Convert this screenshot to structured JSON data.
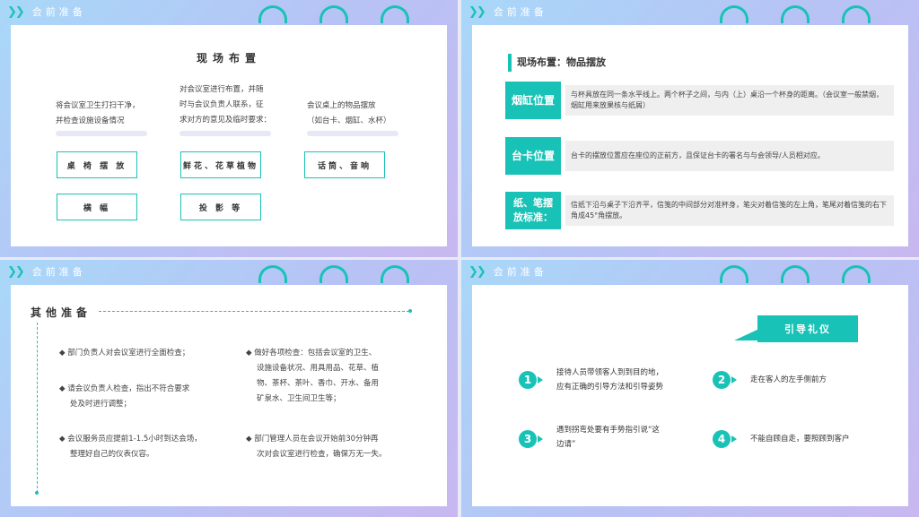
{
  "section_header": "会前准备",
  "panel1": {
    "title": "现场布置",
    "col1": [
      "将会议室卫生打扫干净，",
      "并检查设施设备情况"
    ],
    "col2": [
      "对会议室进行布置，并随",
      "时与会议负责人联系，征",
      "求对方的意见及临时要求："
    ],
    "col3": [
      "会议桌上的物品摆放",
      "（如台卡、烟缸、水杯）"
    ],
    "boxes": [
      "桌 椅 摆 放",
      "鲜花、花草植物",
      "话筒、音响",
      "横 幅",
      "投 影 等"
    ]
  },
  "panel2": {
    "title": "现场布置：物品摆放",
    "rows": [
      {
        "tag": "烟缸位置",
        "text": "与杯具放在同一条水平线上。两个杯子之间，与内（上）桌沿一个杯身的距离。（会议室一般禁烟，烟缸用来放果核与纸屑）"
      },
      {
        "tag": "台卡位置",
        "text": "台卡的摆放位置应在座位的正前方，且保证台卡的署名与与会领导/人员相对应。"
      },
      {
        "tag": "纸、笔摆放标准：",
        "text": "信纸下沿与桌子下沿齐平，信笺的中间部分对准杯身，笔尖对着信笺的左上角，笔尾对着信笺的右下角成45°角摆放。"
      }
    ]
  },
  "panel3": {
    "title": "其他准备",
    "left": [
      [
        "◆ 部门负责人对会议室进行全面检查；"
      ],
      [
        "◆ 请会议负责人检查，指出不符合要求",
        "处及时进行调整；"
      ],
      [
        "◆ 会议服务员应提前1-1.5小时到达会场，",
        "整理好自己的仪表仪容。"
      ]
    ],
    "right": [
      [
        "◆ 做好各项检查：包括会议室的卫生、",
        "设施设备状况、用具用品、花草、植",
        "物、茶杯、茶叶、香巾、开水、备用",
        "矿泉水、卫生间卫生等；"
      ],
      [
        "◆ 部门管理人员在会议开始前30分钟再",
        "次对会议室进行检查，确保万无一失。"
      ]
    ]
  },
  "panel4": {
    "banner": "引导礼仪",
    "steps": [
      {
        "num": "1",
        "lines": [
          "接待人员带领客人到到目的地，",
          "应有正确的引导方法和引导姿势"
        ]
      },
      {
        "num": "2",
        "lines": [
          "走在客人的左手侧前方"
        ]
      },
      {
        "num": "3",
        "lines": [
          "遇到拐弯处要有手势指引说“这",
          "边请”"
        ]
      },
      {
        "num": "4",
        "lines": [
          "不能自顾自走，要照顾到客户"
        ]
      }
    ]
  },
  "colors": {
    "accent": "#19c2b6",
    "bg_from": "#a8d8f8",
    "bg_to": "#c8b8f0"
  }
}
